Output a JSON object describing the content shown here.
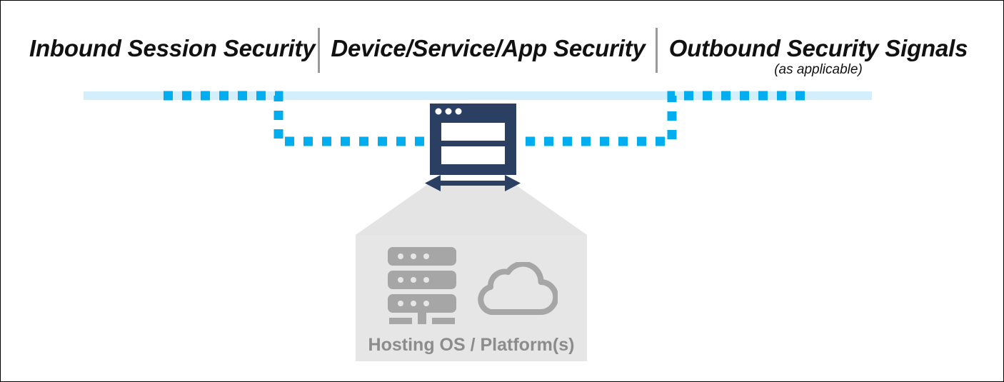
{
  "diagram": {
    "title_columns": [
      {
        "id": "inbound",
        "label": "Inbound Session Security"
      },
      {
        "id": "device",
        "label": "Device/Service/App Security"
      },
      {
        "id": "outbound",
        "label": "Outbound Security Signals",
        "subtitle": "(as applicable)"
      }
    ],
    "platform": {
      "label": "Hosting OS / Platform(s)",
      "icons": [
        "server-stack-icon",
        "cloud-icon"
      ]
    },
    "center_node": {
      "icon": "browser-window-icon",
      "arrow": "bidirectional-arrow-icon"
    },
    "flow": {
      "band_label": "session-flow-band",
      "dashed_path_label": "session-traffic-dashed-path"
    },
    "colors": {
      "band": "#d3effb",
      "dash": "#00adef",
      "navy": "#2b3f63",
      "platform_fill": "#e6e6e6",
      "platform_text": "#8c8c8c",
      "icon_gray": "#a6a6a6",
      "divider": "#9a9a9a",
      "border": "#000000",
      "text": "#111111"
    }
  }
}
